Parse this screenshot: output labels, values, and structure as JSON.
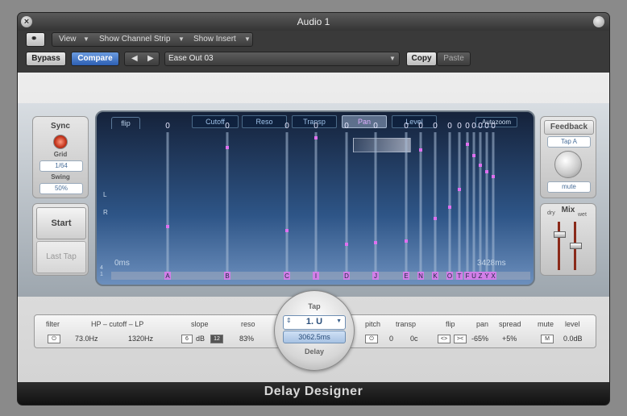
{
  "window": {
    "title": "Audio 1"
  },
  "toolbar": {
    "view": "View",
    "show_channel_strip": "Show Channel Strip",
    "show_insert": "Show Insert",
    "bypass": "Bypass",
    "compare": "Compare",
    "preset": "Ease Out 03",
    "copy": "Copy",
    "paste": "Paste"
  },
  "sync": {
    "title": "Sync",
    "grid_label": "Grid",
    "grid_value": "1/64",
    "swing_label": "Swing",
    "swing_value": "50%"
  },
  "tap_buttons": {
    "start": "Start",
    "last_tap": "Last Tap"
  },
  "view_buttons": {
    "cutoff": "Cutoff",
    "reso": "Reso",
    "transp": "Transp",
    "pan": "Pan",
    "level": "Level",
    "autozoom": "Autozoom"
  },
  "display": {
    "tab": "flip",
    "start_time": "0ms",
    "end_time": "3428ms",
    "left_label": "L",
    "right_label": "R",
    "corner_top": "4",
    "corner_bottom": "1",
    "zero_label": "0"
  },
  "taps": [
    "A",
    "B",
    "C",
    "I",
    "D",
    "J",
    "E",
    "N",
    "K",
    "O",
    "T",
    "F",
    "U",
    "Z",
    "Y",
    "X"
  ],
  "feedback": {
    "title": "Feedback",
    "tap": "Tap A",
    "mute": "mute"
  },
  "mix": {
    "title": "Mix",
    "dry": "dry",
    "wet": "wet"
  },
  "params": {
    "filter": "filter",
    "hp_cutoff_lp": "HP – cutoff – LP",
    "hp_value": "73.0Hz",
    "lp_value": "1320Hz",
    "slope": "slope",
    "slope_6": "6",
    "slope_db": "dB",
    "slope_12": "12",
    "reso": "reso",
    "reso_value": "83%",
    "tap_label": "Tap",
    "tap_value": "1. U",
    "delay_value": "3062.5ms",
    "delay_label": "Delay",
    "pitch": "pitch",
    "transp": "transp",
    "transp_semi": "0",
    "transp_cent": "0c",
    "flip": "flip",
    "pan": "pan",
    "pan_value": "-65%",
    "spread": "spread",
    "spread_value": "+5%",
    "mute": "mute",
    "mute_btn": "M",
    "level": "level",
    "level_value": "0.0dB"
  },
  "footer": {
    "title": "Delay Designer"
  }
}
